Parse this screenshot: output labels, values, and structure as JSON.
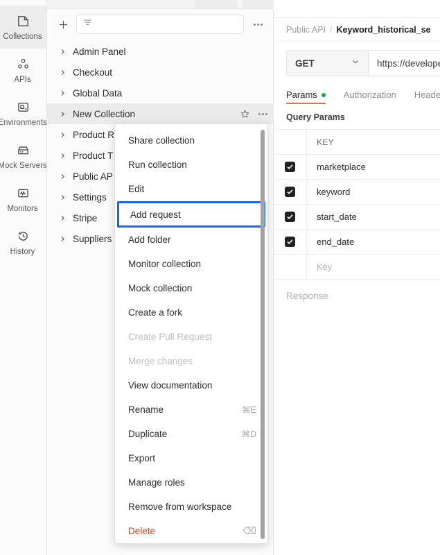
{
  "rail": {
    "items": [
      {
        "label": "Collections",
        "icon": "collections-icon",
        "active": true
      },
      {
        "label": "APIs",
        "icon": "apis-icon",
        "active": false
      },
      {
        "label": "Environments",
        "icon": "environments-icon",
        "active": false
      },
      {
        "label": "Mock Servers",
        "icon": "mock-servers-icon",
        "active": false
      },
      {
        "label": "Monitors",
        "icon": "monitors-icon",
        "active": false
      },
      {
        "label": "History",
        "icon": "history-icon",
        "active": false
      }
    ]
  },
  "sidebar": {
    "toolbar": {
      "new_label": "+",
      "filter_placeholder": "",
      "filter_value": "",
      "more_label": "..."
    },
    "collections": [
      {
        "name": "Admin Panel",
        "selected": false
      },
      {
        "name": "Checkout",
        "selected": false
      },
      {
        "name": "Global Data",
        "selected": false
      },
      {
        "name": "New Collection",
        "selected": true
      },
      {
        "name": "Product R",
        "selected": false
      },
      {
        "name": "Product T",
        "selected": false
      },
      {
        "name": "Public AP",
        "selected": false
      },
      {
        "name": "Settings",
        "selected": false
      },
      {
        "name": "Stripe",
        "selected": false
      },
      {
        "name": "Suppliers",
        "selected": false
      }
    ]
  },
  "context_menu": {
    "items": [
      {
        "label": "Share collection",
        "shortcut": "",
        "state": "normal"
      },
      {
        "label": "Run collection",
        "shortcut": "",
        "state": "normal"
      },
      {
        "label": "Edit",
        "shortcut": "",
        "state": "normal"
      },
      {
        "label": "Add request",
        "shortcut": "",
        "state": "highlighted"
      },
      {
        "label": "Add folder",
        "shortcut": "",
        "state": "normal"
      },
      {
        "label": "Monitor collection",
        "shortcut": "",
        "state": "normal"
      },
      {
        "label": "Mock collection",
        "shortcut": "",
        "state": "normal"
      },
      {
        "label": "Create a fork",
        "shortcut": "",
        "state": "normal"
      },
      {
        "label": "Create Pull Request",
        "shortcut": "",
        "state": "disabled"
      },
      {
        "label": "Merge changes",
        "shortcut": "",
        "state": "disabled"
      },
      {
        "label": "View documentation",
        "shortcut": "",
        "state": "normal"
      },
      {
        "label": "Rename",
        "shortcut": "⌘E",
        "state": "normal"
      },
      {
        "label": "Duplicate",
        "shortcut": "⌘D",
        "state": "normal"
      },
      {
        "label": "Export",
        "shortcut": "",
        "state": "normal"
      },
      {
        "label": "Manage roles",
        "shortcut": "",
        "state": "normal"
      },
      {
        "label": "Remove from workspace",
        "shortcut": "",
        "state": "normal"
      },
      {
        "label": "Delete",
        "shortcut": "⌫",
        "state": "danger"
      }
    ],
    "highlight_color": "#1565f0"
  },
  "main": {
    "breadcrumb": {
      "parent": "Public API",
      "separator": "/",
      "current": "Keyword_historical_se"
    },
    "request": {
      "method": "GET",
      "url": "https://develope"
    },
    "tabs": [
      {
        "label": "Params",
        "active": true,
        "dot": true
      },
      {
        "label": "Authorization",
        "active": false,
        "dot": false
      },
      {
        "label": "Heade",
        "active": false,
        "dot": false
      }
    ],
    "params_section_title": "Query Params",
    "params_table": {
      "headers": {
        "key": "KEY"
      },
      "rows": [
        {
          "checked": true,
          "key": "marketplace"
        },
        {
          "checked": true,
          "key": "keyword"
        },
        {
          "checked": true,
          "key": "start_date"
        },
        {
          "checked": true,
          "key": "end_date"
        }
      ],
      "placeholder_row": {
        "key": "Key"
      }
    },
    "response_label": "Response"
  },
  "colors": {
    "accent_blue": "#1565f0",
    "tab_underline": "#e8744e",
    "status_dot_green": "#18a44c",
    "danger_red": "#bf4128"
  }
}
